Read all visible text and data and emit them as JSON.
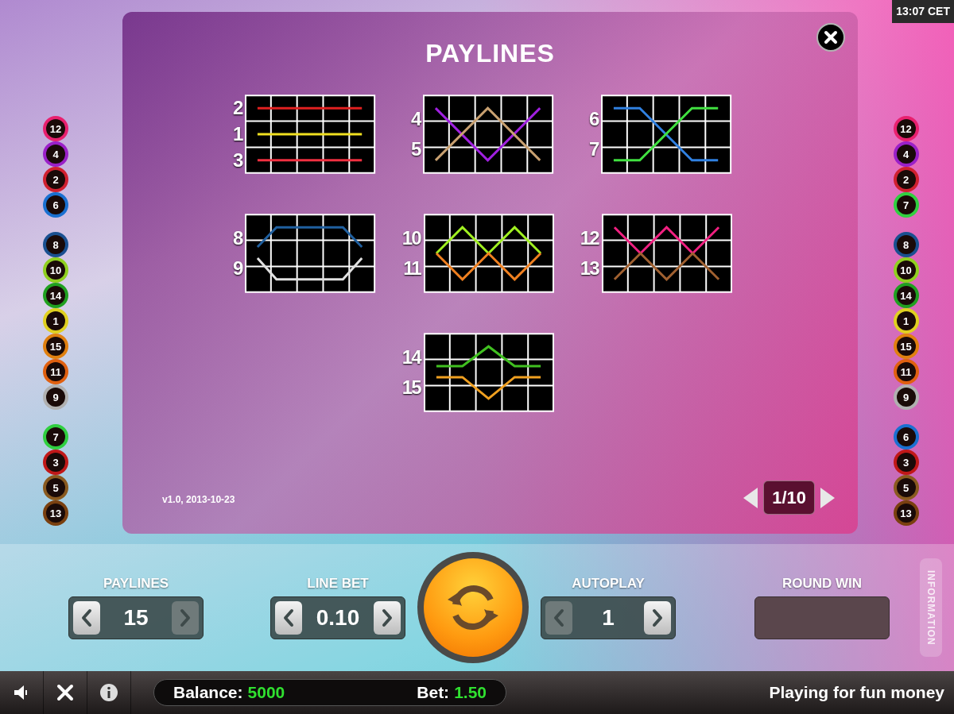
{
  "clock": "13:07 CET",
  "markers_left": [
    {
      "balls": [
        {
          "label": "12",
          "color": "#e8206e"
        },
        {
          "label": "4",
          "color": "#9a20c8"
        },
        {
          "label": "2",
          "color": "#d02030"
        },
        {
          "label": "6",
          "color": "#1a70d0"
        }
      ]
    },
    {
      "balls": [
        {
          "label": "8",
          "color": "#1a5090"
        },
        {
          "label": "10",
          "color": "#90d020"
        },
        {
          "label": "14",
          "color": "#20a020"
        },
        {
          "label": "1",
          "color": "#e0d020"
        },
        {
          "label": "15",
          "color": "#e08010"
        },
        {
          "label": "11",
          "color": "#e06010"
        },
        {
          "label": "9",
          "color": "#b0b0b0"
        }
      ]
    },
    {
      "balls": [
        {
          "label": "7",
          "color": "#30d040"
        },
        {
          "label": "3",
          "color": "#c01818"
        },
        {
          "label": "5",
          "color": "#8a5a20"
        },
        {
          "label": "13",
          "color": "#7a4010"
        }
      ]
    }
  ],
  "markers_right": [
    {
      "balls": [
        {
          "label": "12",
          "color": "#e8206e"
        },
        {
          "label": "4",
          "color": "#9a20c8"
        },
        {
          "label": "2",
          "color": "#d02030"
        },
        {
          "label": "7",
          "color": "#30d040"
        }
      ]
    },
    {
      "balls": [
        {
          "label": "8",
          "color": "#1a5090"
        },
        {
          "label": "10",
          "color": "#90d020"
        },
        {
          "label": "14",
          "color": "#20a020"
        },
        {
          "label": "1",
          "color": "#e0d020"
        },
        {
          "label": "15",
          "color": "#e08010"
        },
        {
          "label": "11",
          "color": "#e06010"
        },
        {
          "label": "9",
          "color": "#b0b0b0"
        }
      ]
    },
    {
      "balls": [
        {
          "label": "6",
          "color": "#1a70d0"
        },
        {
          "label": "3",
          "color": "#c01818"
        },
        {
          "label": "5",
          "color": "#8a5a20"
        },
        {
          "label": "13",
          "color": "#7a4010"
        }
      ]
    }
  ],
  "dialog": {
    "title": "PAYLINES",
    "version": "v1.0, 2013-10-23",
    "pager": "1/10",
    "panels": [
      {
        "lines": [
          {
            "label": "2",
            "color": "#e02020"
          },
          {
            "label": "1",
            "color": "#f0e020"
          },
          {
            "label": "3",
            "color": "#f03040"
          }
        ]
      },
      {
        "lines": [
          {
            "label": "4",
            "color": "#a020e0"
          },
          {
            "label": "5",
            "color": "#c8a070"
          }
        ]
      },
      {
        "lines": [
          {
            "label": "6",
            "color": "#3080e0"
          },
          {
            "label": "7",
            "color": "#40e040"
          }
        ]
      },
      {
        "lines": [
          {
            "label": "8",
            "color": "#2060a0"
          },
          {
            "label": "9",
            "color": "#e0e0e0"
          }
        ]
      },
      {
        "lines": [
          {
            "label": "10",
            "color": "#a0f020"
          },
          {
            "label": "11",
            "color": "#f08020"
          }
        ]
      },
      {
        "lines": [
          {
            "label": "12",
            "color": "#f02080"
          },
          {
            "label": "13",
            "color": "#a06030"
          }
        ]
      },
      {
        "lines": [
          {
            "label": "14",
            "color": "#40c020"
          },
          {
            "label": "15",
            "color": "#f0a020"
          }
        ]
      }
    ]
  },
  "controls": [
    {
      "kind": "stepper",
      "label": "PAYLINES",
      "value": "15",
      "prev_disabled": false,
      "next_disabled": true
    },
    {
      "kind": "stepper",
      "label": "LINE BET",
      "value": "0.10",
      "prev_disabled": false,
      "next_disabled": false
    },
    {
      "kind": "spin"
    },
    {
      "kind": "stepper",
      "label": "AUTOPLAY",
      "value": "1",
      "prev_disabled": true,
      "next_disabled": false
    },
    {
      "kind": "display",
      "label": "ROUND WIN"
    },
    {
      "kind": "tab",
      "label": "INFORMATION"
    }
  ],
  "status_bar": {
    "balance_label": "Balance:",
    "balance": "5000",
    "bet_label": "Bet:",
    "bet": "1.50",
    "message": "Playing for fun money"
  }
}
